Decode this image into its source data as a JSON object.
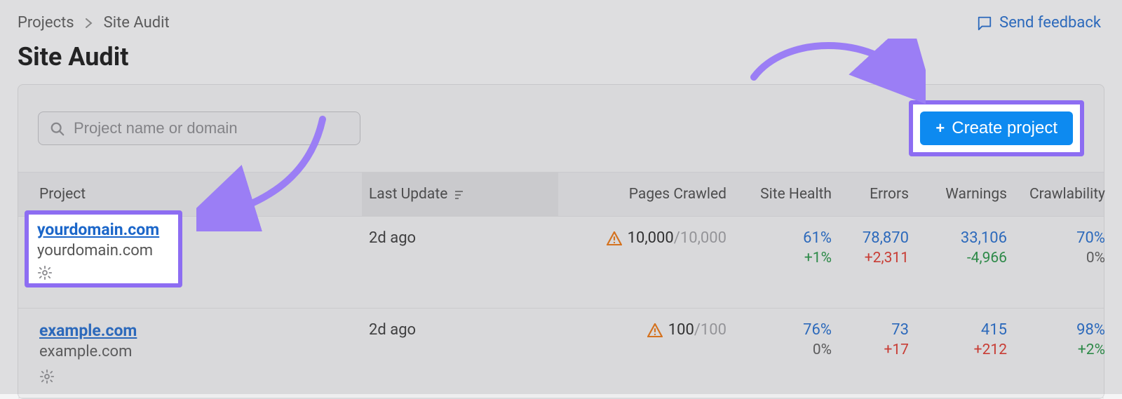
{
  "breadcrumbs": {
    "root": "Projects",
    "current": "Site Audit"
  },
  "page_title": "Site Audit",
  "feedback_label": "Send feedback",
  "search": {
    "placeholder": "Project name or domain"
  },
  "create_button": "Create project",
  "columns": {
    "project": "Project",
    "last_update": "Last Update",
    "pages_crawled": "Pages Crawled",
    "site_health": "Site Health",
    "errors": "Errors",
    "warnings": "Warnings",
    "crawlability": "Crawlability"
  },
  "rows": [
    {
      "name": "yourdomain.com",
      "domain": "yourdomain.com",
      "last_update": "2d ago",
      "crawled_done": "10,000",
      "crawled_total": "10,000",
      "health": "61%",
      "health_delta": "+1%",
      "errors": "78,870",
      "errors_delta": "+2,311",
      "warnings": "33,106",
      "warnings_delta": "-4,966",
      "crawlability": "70%",
      "crawlability_delta": "0%"
    },
    {
      "name": "example.com",
      "domain": "example.com",
      "last_update": "2d ago",
      "crawled_done": "100",
      "crawled_total": "100",
      "health": "76%",
      "health_delta": "0%",
      "errors": "73",
      "errors_delta": "+17",
      "warnings": "415",
      "warnings_delta": "+212",
      "crawlability": "98%",
      "crawlability_delta": "+2%"
    }
  ]
}
